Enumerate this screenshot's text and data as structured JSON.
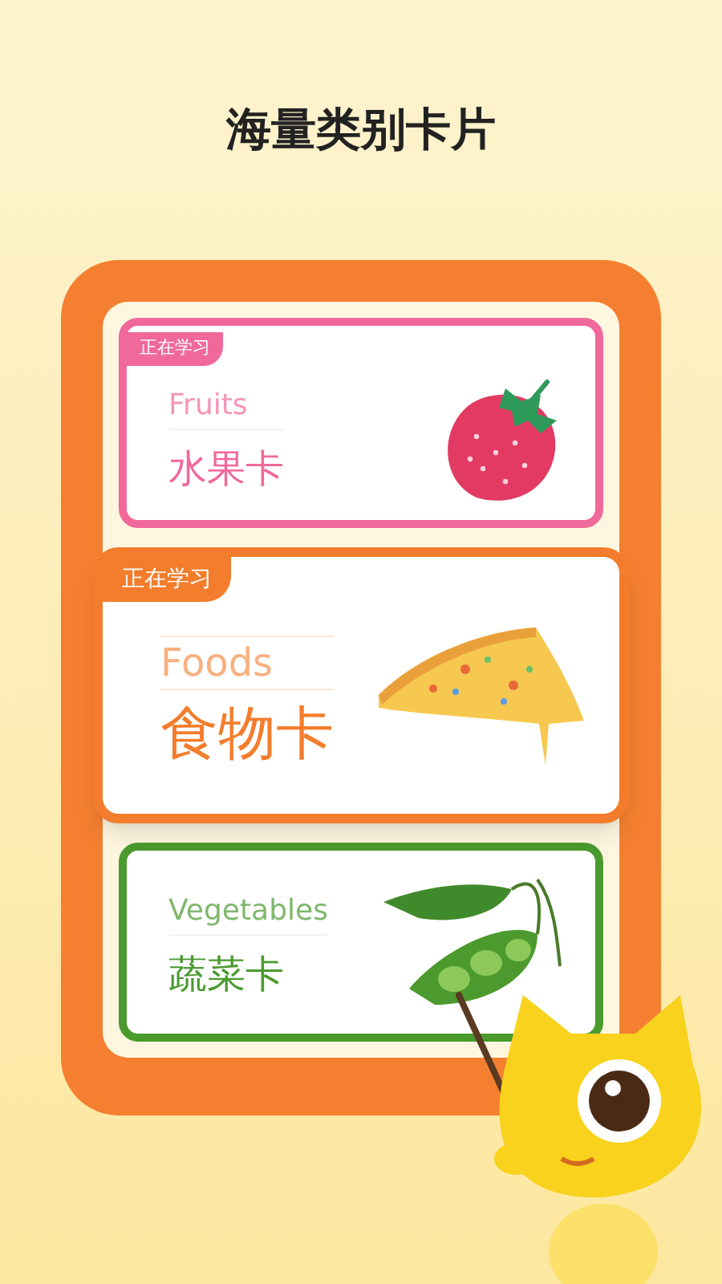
{
  "title": "海量类别卡片",
  "cards": [
    {
      "kind": "fruit",
      "tag": "正在学习",
      "english": "Fruits",
      "chinese": "水果卡",
      "color": "#f0699a",
      "selected": false
    },
    {
      "kind": "food",
      "tag": "正在学习",
      "english": "Foods",
      "chinese": "食物卡",
      "color": "#f37d2c",
      "selected": true
    },
    {
      "kind": "vegetable",
      "english": "Vegetables",
      "chinese": "蔬菜卡",
      "color": "#4a9a2e",
      "selected": false
    }
  ]
}
